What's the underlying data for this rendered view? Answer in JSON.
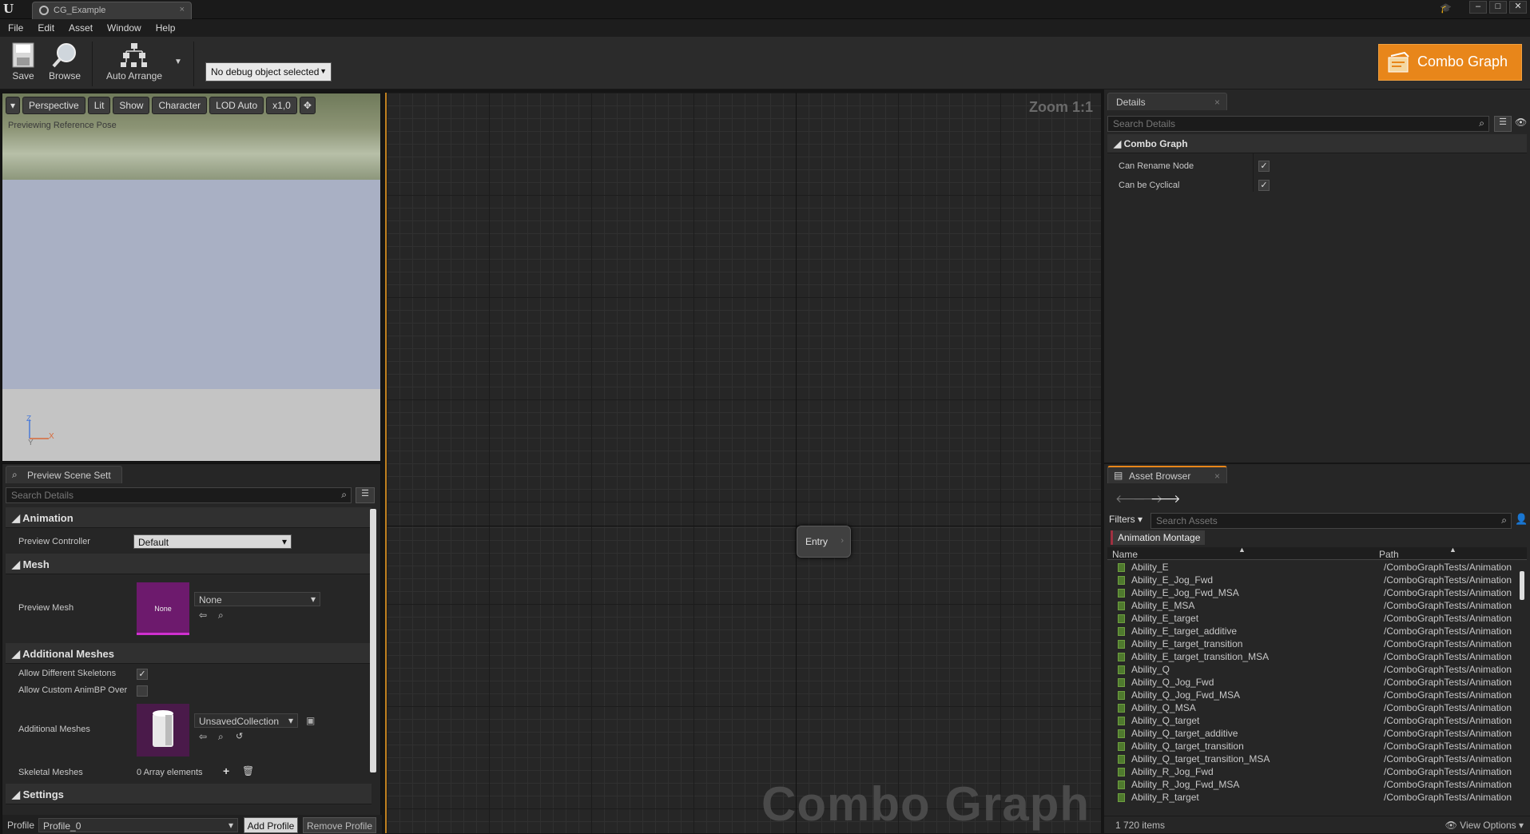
{
  "window": {
    "tab_title": "CG_Example",
    "tab_close": "×",
    "logo": "U",
    "controls": [
      "–",
      "□",
      "✕"
    ]
  },
  "menu": [
    "File",
    "Edit",
    "Asset",
    "Window",
    "Help"
  ],
  "toolbar": {
    "save_label": "Save",
    "browse_label": "Browse",
    "auto_arrange_label": "Auto Arrange",
    "debug_select": "No debug object selected",
    "brand_label": "Combo Graph"
  },
  "viewport": {
    "buttons": [
      "Perspective",
      "Lit",
      "Show",
      "Character",
      "LOD Auto",
      "x1,0"
    ],
    "preview_label": "Previewing Reference Pose",
    "axis_z": "Z",
    "axis_x": "X",
    "axis_y": "Y"
  },
  "preview_scene": {
    "tab_label": "Preview Scene Sett",
    "search_placeholder": "Search Details",
    "categories": {
      "animation": "Animation",
      "mesh": "Mesh",
      "additional_meshes": "Additional Meshes",
      "settings": "Settings"
    },
    "preview_controller_label": "Preview Controller",
    "preview_controller_value": "Default",
    "preview_mesh_label": "Preview Mesh",
    "preview_mesh_thumb": "None",
    "preview_mesh_value": "None",
    "allow_diff_skeletons_label": "Allow Different Skeletons",
    "allow_custom_animbp_label": "Allow Custom AnimBP Over",
    "additional_meshes_label": "Additional Meshes",
    "additional_meshes_value": "UnsavedCollection",
    "skeletal_meshes_label": "Skeletal Meshes",
    "skeletal_meshes_value": "0 Array elements",
    "profile_label": "Profile",
    "profile_value": "Profile_0",
    "add_profile": "Add Profile",
    "remove_profile": "Remove Profile"
  },
  "graph": {
    "zoom": "Zoom 1:1",
    "entry_node": "Entry",
    "watermark": "Combo Graph"
  },
  "details": {
    "tab_label": "Details",
    "search_placeholder": "Search Details",
    "category": "Combo Graph",
    "props": [
      {
        "label": "Can Rename Node",
        "checked": true
      },
      {
        "label": "Can be Cyclical",
        "checked": true
      }
    ]
  },
  "asset_browser": {
    "tab_label": "Asset Browser",
    "filters_label": "Filters",
    "search_placeholder": "Search Assets",
    "filter_chip": "Animation Montage",
    "col_name": "Name",
    "col_path": "Path",
    "items": [
      {
        "name": "Ability_E",
        "path": "/ComboGraphTests/Animation"
      },
      {
        "name": "Ability_E_Jog_Fwd",
        "path": "/ComboGraphTests/Animation"
      },
      {
        "name": "Ability_E_Jog_Fwd_MSA",
        "path": "/ComboGraphTests/Animation"
      },
      {
        "name": "Ability_E_MSA",
        "path": "/ComboGraphTests/Animation"
      },
      {
        "name": "Ability_E_target",
        "path": "/ComboGraphTests/Animation"
      },
      {
        "name": "Ability_E_target_additive",
        "path": "/ComboGraphTests/Animation"
      },
      {
        "name": "Ability_E_target_transition",
        "path": "/ComboGraphTests/Animation"
      },
      {
        "name": "Ability_E_target_transition_MSA",
        "path": "/ComboGraphTests/Animation"
      },
      {
        "name": "Ability_Q",
        "path": "/ComboGraphTests/Animation"
      },
      {
        "name": "Ability_Q_Jog_Fwd",
        "path": "/ComboGraphTests/Animation"
      },
      {
        "name": "Ability_Q_Jog_Fwd_MSA",
        "path": "/ComboGraphTests/Animation"
      },
      {
        "name": "Ability_Q_MSA",
        "path": "/ComboGraphTests/Animation"
      },
      {
        "name": "Ability_Q_target",
        "path": "/ComboGraphTests/Animation"
      },
      {
        "name": "Ability_Q_target_additive",
        "path": "/ComboGraphTests/Animation"
      },
      {
        "name": "Ability_Q_target_transition",
        "path": "/ComboGraphTests/Animation"
      },
      {
        "name": "Ability_Q_target_transition_MSA",
        "path": "/ComboGraphTests/Animation"
      },
      {
        "name": "Ability_R_Jog_Fwd",
        "path": "/ComboGraphTests/Animation"
      },
      {
        "name": "Ability_R_Jog_Fwd_MSA",
        "path": "/ComboGraphTests/Animation"
      },
      {
        "name": "Ability_R_target",
        "path": "/ComboGraphTests/Animation"
      }
    ],
    "item_count": "1 720 items",
    "view_options": "View Options"
  }
}
